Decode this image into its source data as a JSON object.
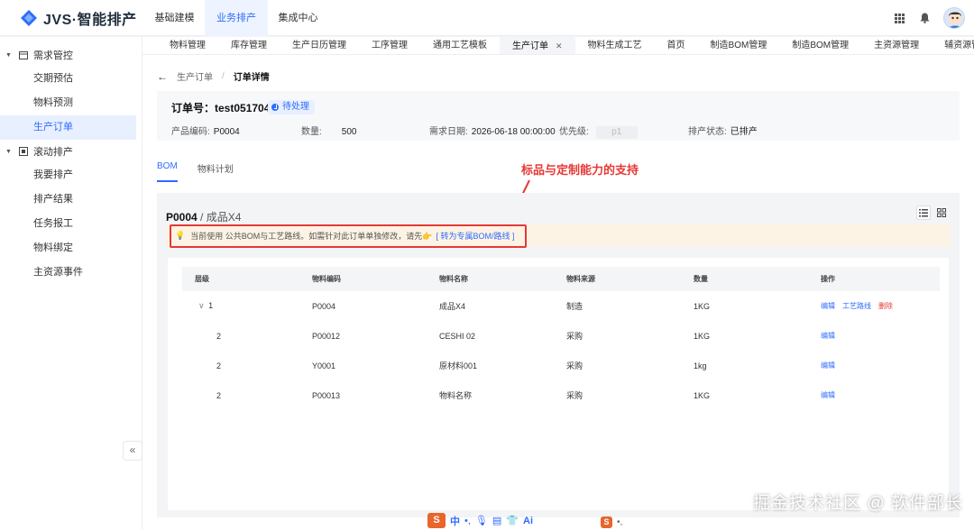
{
  "app": {
    "title": "JVS·智能排产"
  },
  "topnav": [
    "基础建模",
    "业务排产",
    "集成中心"
  ],
  "sidebar": {
    "groups": [
      {
        "label": "需求管控",
        "items": [
          "交期预估",
          "物料预测",
          "生产订单"
        ]
      },
      {
        "label": "滚动排产",
        "items": [
          "我要排产",
          "排产结果",
          "任务报工",
          "物料绑定",
          "主资源事件"
        ]
      }
    ],
    "collapse": "«"
  },
  "tabs": [
    "物料管理",
    "库存管理",
    "生产日历管理",
    "工序管理",
    "通用工艺模板",
    "生产订单",
    "物料生成工艺",
    "首页",
    "制造BOM管理",
    "制造BOM管理",
    "主资源管理",
    "辅资源管理"
  ],
  "breadcrumb": {
    "back": "←",
    "parent": "生产订单",
    "sep": "/",
    "current": "订单详情"
  },
  "order": {
    "title": "订单号：test051704",
    "status": "待处理",
    "product_code_label": "产品编码:",
    "product_code": "P0004",
    "qty_label": "数量:",
    "qty": "500",
    "date_label": "需求日期:",
    "date": "2026-06-18 00:00:00",
    "priority_label": "优先级:",
    "priority": "p1",
    "sched_label": "排产状态:",
    "sched": "已排产"
  },
  "subtabs": [
    "BOM",
    "物料计划"
  ],
  "annotation": "标品与定制能力的支持",
  "bom": {
    "code": "P0004",
    "sep": " / ",
    "name": "成品X4",
    "notice": "当前使用 公共BOM与工艺路线。如需针对此订单单独修改，请先👉",
    "notice_link": "[ 转为专属BOM/路线 ]",
    "columns": [
      "层级",
      "物料编码",
      "物料名称",
      "物料来源",
      "数量",
      "操作"
    ],
    "rows": [
      {
        "level": "1",
        "code": "P0004",
        "name": "成品X4",
        "source": "制造",
        "qty": "1KG",
        "ops": [
          "编辑",
          "工艺路线",
          "删除"
        ]
      },
      {
        "level": "2",
        "code": "P00012",
        "name": "CESHI 02",
        "source": "采购",
        "qty": "1KG",
        "ops": [
          "编辑"
        ]
      },
      {
        "level": "2",
        "code": "Y0001",
        "name": "原材料001",
        "source": "采购",
        "qty": "1kg",
        "ops": [
          "编辑"
        ]
      },
      {
        "level": "2",
        "code": "P00013",
        "name": "物料名称",
        "source": "采购",
        "qty": "1KG",
        "ops": [
          "编辑"
        ]
      }
    ]
  },
  "watermark": "掘金技术社区 @ 软件部长",
  "ime": {
    "s": "S",
    "zh": "中",
    "dot": "•,",
    "ai": "Ai"
  },
  "colors": {
    "primary": "#2f6bff",
    "danger": "#e53935",
    "notice_bg": "#fdf3e4"
  }
}
